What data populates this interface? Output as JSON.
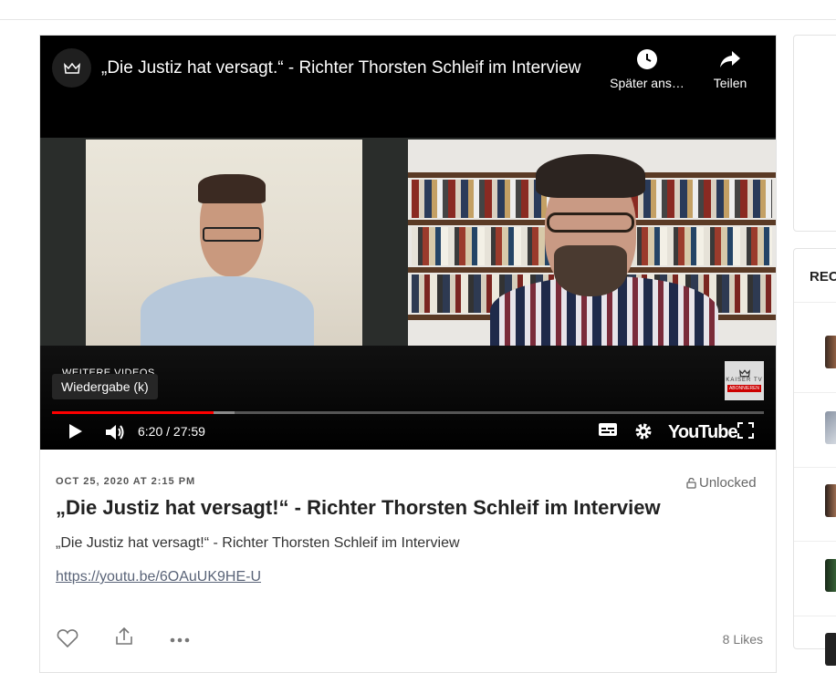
{
  "player": {
    "title": "„Die Justiz hat versagt.“ - Richter Thorsten Schleif im Interview",
    "watch_later_label": "Später ans…",
    "share_label": "Teilen",
    "more_videos_label": "WEITERE VIDEOS",
    "tooltip": "Wiedergabe (k)",
    "branding_text": "KAISER TV",
    "branding_subscribe": "ABONNIEREN",
    "time": "6:20 / 27:59",
    "progress_played_fraction": 0.227,
    "progress_buffered_fraction": 0.256,
    "youtube_logo": "YouTube"
  },
  "post": {
    "date": "OCT 25, 2020 AT 2:15 PM",
    "unlocked_label": "Unlocked",
    "title": "„Die Justiz hat versagt!“ - Richter Thorsten Schleif im Interview",
    "description": "„Die Justiz hat versagt!“ - Richter Thorsten Schleif im Interview",
    "link": "https://youtu.be/6OAuUK9HE-U",
    "likes_label": "8 Likes"
  },
  "sidebar": {
    "heading": "REC"
  },
  "colors": {
    "progress_played": "#ff0000",
    "link": "#5a6478"
  }
}
